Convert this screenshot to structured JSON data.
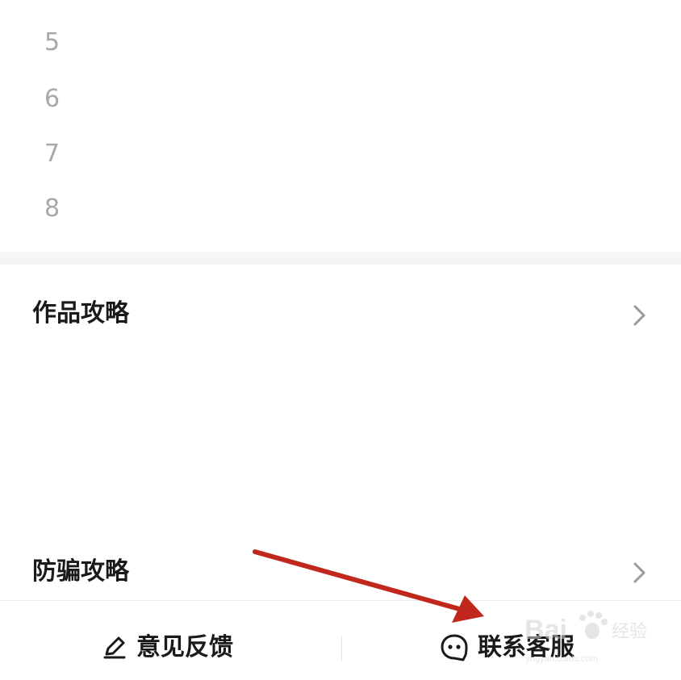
{
  "numbers": [
    "5",
    "6",
    "7",
    "8"
  ],
  "menu": {
    "items": [
      {
        "label": "作品攻略",
        "icon": "chevron-right-icon"
      },
      {
        "label": "防骗攻略",
        "icon": "chevron-right-icon"
      }
    ]
  },
  "bottom_bar": {
    "feedback_label": "意见反馈",
    "feedback_icon": "edit-pen-icon",
    "contact_label": "联系客服",
    "contact_icon": "chat-bubble-icon"
  },
  "annotation": {
    "color": "#c0281e",
    "icon": "red-arrow"
  },
  "watermark": {
    "brand": "Bai",
    "brand_tail": "经验",
    "url": "jingyan.baidu.com"
  }
}
